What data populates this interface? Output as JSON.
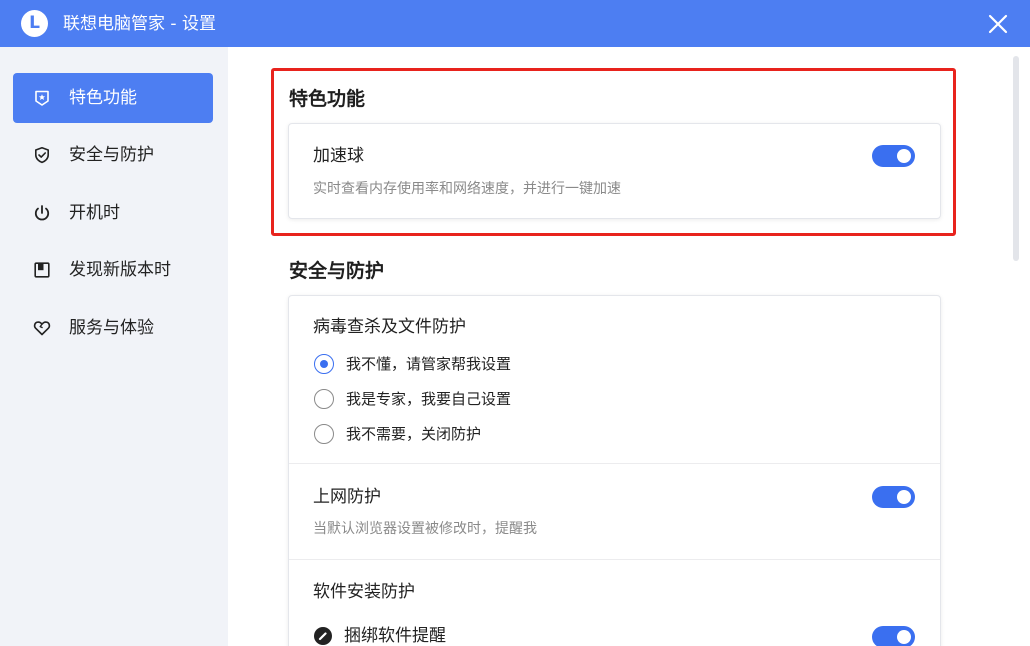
{
  "window": {
    "logo_letter": "L",
    "title": "联想电脑管家 - 设置",
    "close_icon": "close-icon"
  },
  "colors": {
    "accent": "#4d7ef2",
    "toggle_on": "#3a6ff0",
    "highlight": "#e8231d",
    "sidebar_bg": "#f1f3f8"
  },
  "sidebar": {
    "items": [
      {
        "label": "特色功能",
        "icon": "star-shield-icon",
        "active": true
      },
      {
        "label": "安全与防护",
        "icon": "shield-check-icon",
        "active": false
      },
      {
        "label": "开机时",
        "icon": "power-icon",
        "active": false
      },
      {
        "label": "发现新版本时",
        "icon": "update-box-icon",
        "active": false
      },
      {
        "label": "服务与体验",
        "icon": "heart-icon",
        "active": false
      }
    ]
  },
  "featured": {
    "title": "特色功能",
    "accelerator": {
      "title": "加速球",
      "description": "实时查看内存使用率和网络速度，并进行一键加速",
      "enabled": true
    }
  },
  "security": {
    "title": "安全与防护",
    "virus": {
      "title": "病毒查杀及文件防护",
      "options": [
        {
          "label": "我不懂，请管家帮我设置",
          "checked": true
        },
        {
          "label": "我是专家，我要自己设置",
          "checked": false
        },
        {
          "label": "我不需要，关闭防护",
          "checked": false
        }
      ]
    },
    "web": {
      "title": "上网防护",
      "description": "当默认浏览器设置被修改时，提醒我",
      "enabled": true
    },
    "install": {
      "title": "软件安装防护",
      "bundle_label": "捆绑软件提醒",
      "bundle_enabled": true
    }
  }
}
